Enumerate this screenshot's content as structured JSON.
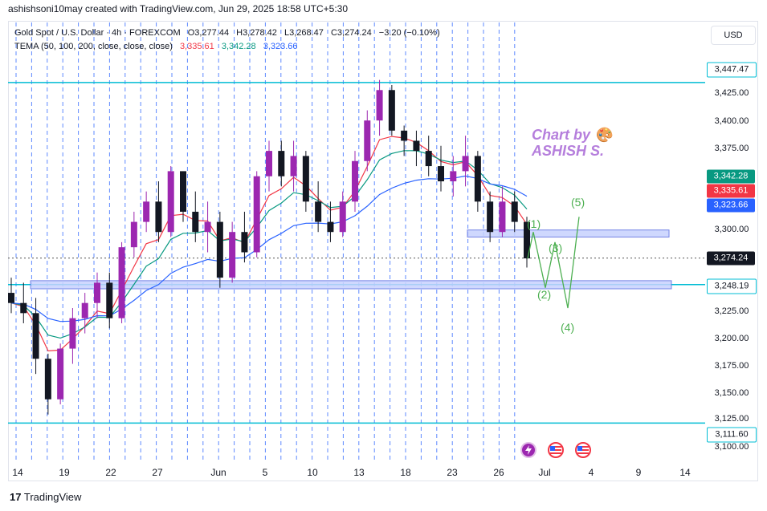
{
  "header": {
    "creator_line": "ashishsoni10may created with TradingView.com, Jun 29, 2025 18:58 UTC+5:30"
  },
  "legend": {
    "symbol": "Gold Spot / U.S. Dollar · 4h · FOREXCOM",
    "open": "O3,277.44",
    "high": "H3,278.42",
    "low": "L3,268.47",
    "close": "C3,274.24",
    "change": "−3.20 (−0.10%)",
    "indicator": "TEMA (50, 100, 200, close, close, close)",
    "tema1": "3,335.61",
    "tema2": "3,342.28",
    "tema3": "3,323.66"
  },
  "currency_button": "USD",
  "watermark": {
    "line1": "Chart by 🎨",
    "line2": "ASHISH S."
  },
  "price_axis": [
    "3,425.00",
    "3,400.00",
    "3,375.00",
    "3,300.00",
    "3,225.00",
    "3,200.00",
    "3,175.00",
    "3,150.00",
    "3,125.00",
    "3,100.00"
  ],
  "price_badges": {
    "top_level": "3,447.47",
    "green_tema": "3,342.28",
    "red_tema": "3,335.61",
    "blue_tema": "3,323.66",
    "last_price": "3,274.24",
    "support": "3,248.19",
    "bottom_level": "3,111.60"
  },
  "time_axis": [
    "14",
    "19",
    "22",
    "27",
    "Jun",
    "5",
    "10",
    "13",
    "18",
    "23",
    "26",
    "Jul",
    "4",
    "9",
    "14"
  ],
  "wave_labels": [
    "(1)",
    "(2)",
    "(3)",
    "(4)",
    "(5)"
  ],
  "footer": {
    "brand": "TradingView"
  },
  "colors": {
    "up": "#9c27b0",
    "down": "#131722",
    "cyan": "#00bcd4",
    "tema_red": "#f23645",
    "tema_green": "#089981",
    "tema_blue": "#2962ff",
    "wave": "#4caf50",
    "zone_fill": "#c7d2fe",
    "zone_border": "#5b6ee1"
  },
  "chart_data": {
    "type": "candlestick",
    "ylim": [
      3100,
      3460
    ],
    "series": [
      {
        "name": "Gold Spot / U.S. Dollar",
        "ohlc_estimated": [
          [
            3240,
            3255,
            3220,
            3230
          ],
          [
            3230,
            3250,
            3210,
            3220
          ],
          [
            3220,
            3235,
            3160,
            3175
          ],
          [
            3175,
            3180,
            3120,
            3135
          ],
          [
            3135,
            3190,
            3130,
            3185
          ],
          [
            3185,
            3225,
            3170,
            3215
          ],
          [
            3215,
            3240,
            3200,
            3230
          ],
          [
            3230,
            3260,
            3215,
            3250
          ],
          [
            3250,
            3260,
            3205,
            3215
          ],
          [
            3215,
            3290,
            3210,
            3285
          ],
          [
            3285,
            3320,
            3275,
            3310
          ],
          [
            3310,
            3340,
            3300,
            3330
          ],
          [
            3330,
            3350,
            3290,
            3300
          ],
          [
            3300,
            3365,
            3295,
            3360
          ],
          [
            3360,
            3355,
            3310,
            3320
          ],
          [
            3320,
            3340,
            3290,
            3300
          ],
          [
            3300,
            3330,
            3280,
            3310
          ],
          [
            3310,
            3320,
            3245,
            3255
          ],
          [
            3255,
            3310,
            3250,
            3300
          ],
          [
            3300,
            3320,
            3270,
            3280
          ],
          [
            3280,
            3360,
            3275,
            3355
          ],
          [
            3355,
            3390,
            3340,
            3380
          ],
          [
            3380,
            3390,
            3345,
            3355
          ],
          [
            3355,
            3390,
            3340,
            3375
          ],
          [
            3375,
            3380,
            3320,
            3330
          ],
          [
            3330,
            3350,
            3300,
            3310
          ],
          [
            3310,
            3330,
            3290,
            3300
          ],
          [
            3300,
            3340,
            3295,
            3330
          ],
          [
            3330,
            3380,
            3320,
            3370
          ],
          [
            3370,
            3420,
            3360,
            3410
          ],
          [
            3410,
            3450,
            3395,
            3440
          ],
          [
            3440,
            3445,
            3395,
            3400
          ],
          [
            3400,
            3405,
            3375,
            3390
          ],
          [
            3390,
            3400,
            3365,
            3380
          ],
          [
            3380,
            3395,
            3355,
            3365
          ],
          [
            3365,
            3385,
            3340,
            3350
          ],
          [
            3350,
            3375,
            3335,
            3360
          ],
          [
            3360,
            3395,
            3345,
            3375
          ],
          [
            3375,
            3380,
            3320,
            3330
          ],
          [
            3330,
            3340,
            3290,
            3300
          ],
          [
            3300,
            3345,
            3295,
            3330
          ],
          [
            3330,
            3340,
            3300,
            3310
          ],
          [
            3310,
            3315,
            3265,
            3274
          ]
        ]
      },
      {
        "name": "TEMA 50",
        "color": "#f23645",
        "last": 3335.61
      },
      {
        "name": "TEMA 100",
        "color": "#089981",
        "last": 3342.28
      },
      {
        "name": "TEMA 200",
        "color": "#2962ff",
        "last": 3323.66
      }
    ],
    "levels": [
      3447.47,
      3248.19,
      3111.6
    ],
    "zones": [
      [
        3295,
        3302
      ],
      [
        3244,
        3252
      ]
    ],
    "projected_wave": [
      [
        0,
        3274
      ],
      [
        1,
        3300
      ],
      [
        2,
        3245
      ],
      [
        3,
        3290
      ],
      [
        4,
        3225
      ],
      [
        5,
        3315
      ]
    ]
  }
}
